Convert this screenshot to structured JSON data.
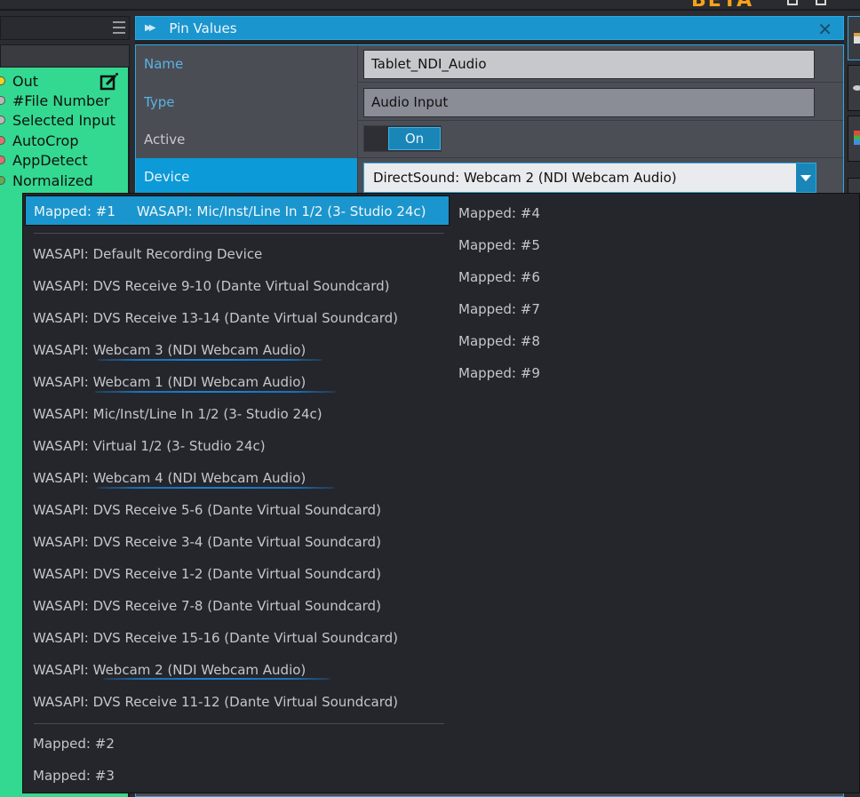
{
  "app": {
    "badge": "BETA"
  },
  "node": {
    "pins": [
      {
        "label": "Out",
        "color": "#f2d21b"
      },
      {
        "label": "#File Number",
        "color": "#b8b8b8"
      },
      {
        "label": "Selected Input",
        "color": "#b8b8b8"
      },
      {
        "label": "AutoCrop",
        "color": "#e07070"
      },
      {
        "label": "AppDetect",
        "color": "#e07070"
      },
      {
        "label": "Normalized",
        "color": "#6aa84f"
      }
    ]
  },
  "pin_values": {
    "title": "Pin Values",
    "rows": {
      "name": {
        "label": "Name",
        "value": "Tablet_NDI_Audio"
      },
      "type": {
        "label": "Type",
        "value": "Audio Input"
      },
      "active": {
        "label": "Active",
        "value": "On"
      },
      "device": {
        "label": "Device",
        "value": "DirectSound: Webcam 2 (NDI Webcam Audio)"
      }
    }
  },
  "dropdown": {
    "highlighted": {
      "mapped": "Mapped: #1",
      "device": "WASAPI: Mic/Inst/Line In 1/2 (3- Studio 24c)"
    },
    "devices": [
      "WASAPI: Default Recording Device",
      "WASAPI: DVS Receive  9-10 (Dante Virtual Soundcard)",
      "WASAPI: DVS Receive 13-14 (Dante Virtual Soundcard)",
      "WASAPI: Webcam 3 (NDI Webcam Audio)",
      "WASAPI: Webcam 1 (NDI Webcam Audio)",
      "WASAPI: Mic/Inst/Line In 1/2 (3- Studio 24c)",
      "WASAPI: Virtual 1/2 (3- Studio 24c)",
      "WASAPI: Webcam 4 (NDI Webcam Audio)",
      "WASAPI: DVS Receive  5-6 (Dante Virtual Soundcard)",
      "WASAPI: DVS Receive  3-4 (Dante Virtual Soundcard)",
      "WASAPI: DVS Receive  1-2 (Dante Virtual Soundcard)",
      "WASAPI: DVS Receive  7-8 (Dante Virtual Soundcard)",
      "WASAPI: DVS Receive 15-16 (Dante Virtual Soundcard)",
      "WASAPI: Webcam 2 (NDI Webcam Audio)",
      "WASAPI: DVS Receive 11-12 (Dante Virtual Soundcard)"
    ],
    "mapped_left": [
      "Mapped: #2",
      "Mapped: #3"
    ],
    "mapped_right": [
      "Mapped: #4",
      "Mapped: #5",
      "Mapped: #6",
      "Mapped: #7",
      "Mapped: #8",
      "Mapped: #9"
    ]
  }
}
